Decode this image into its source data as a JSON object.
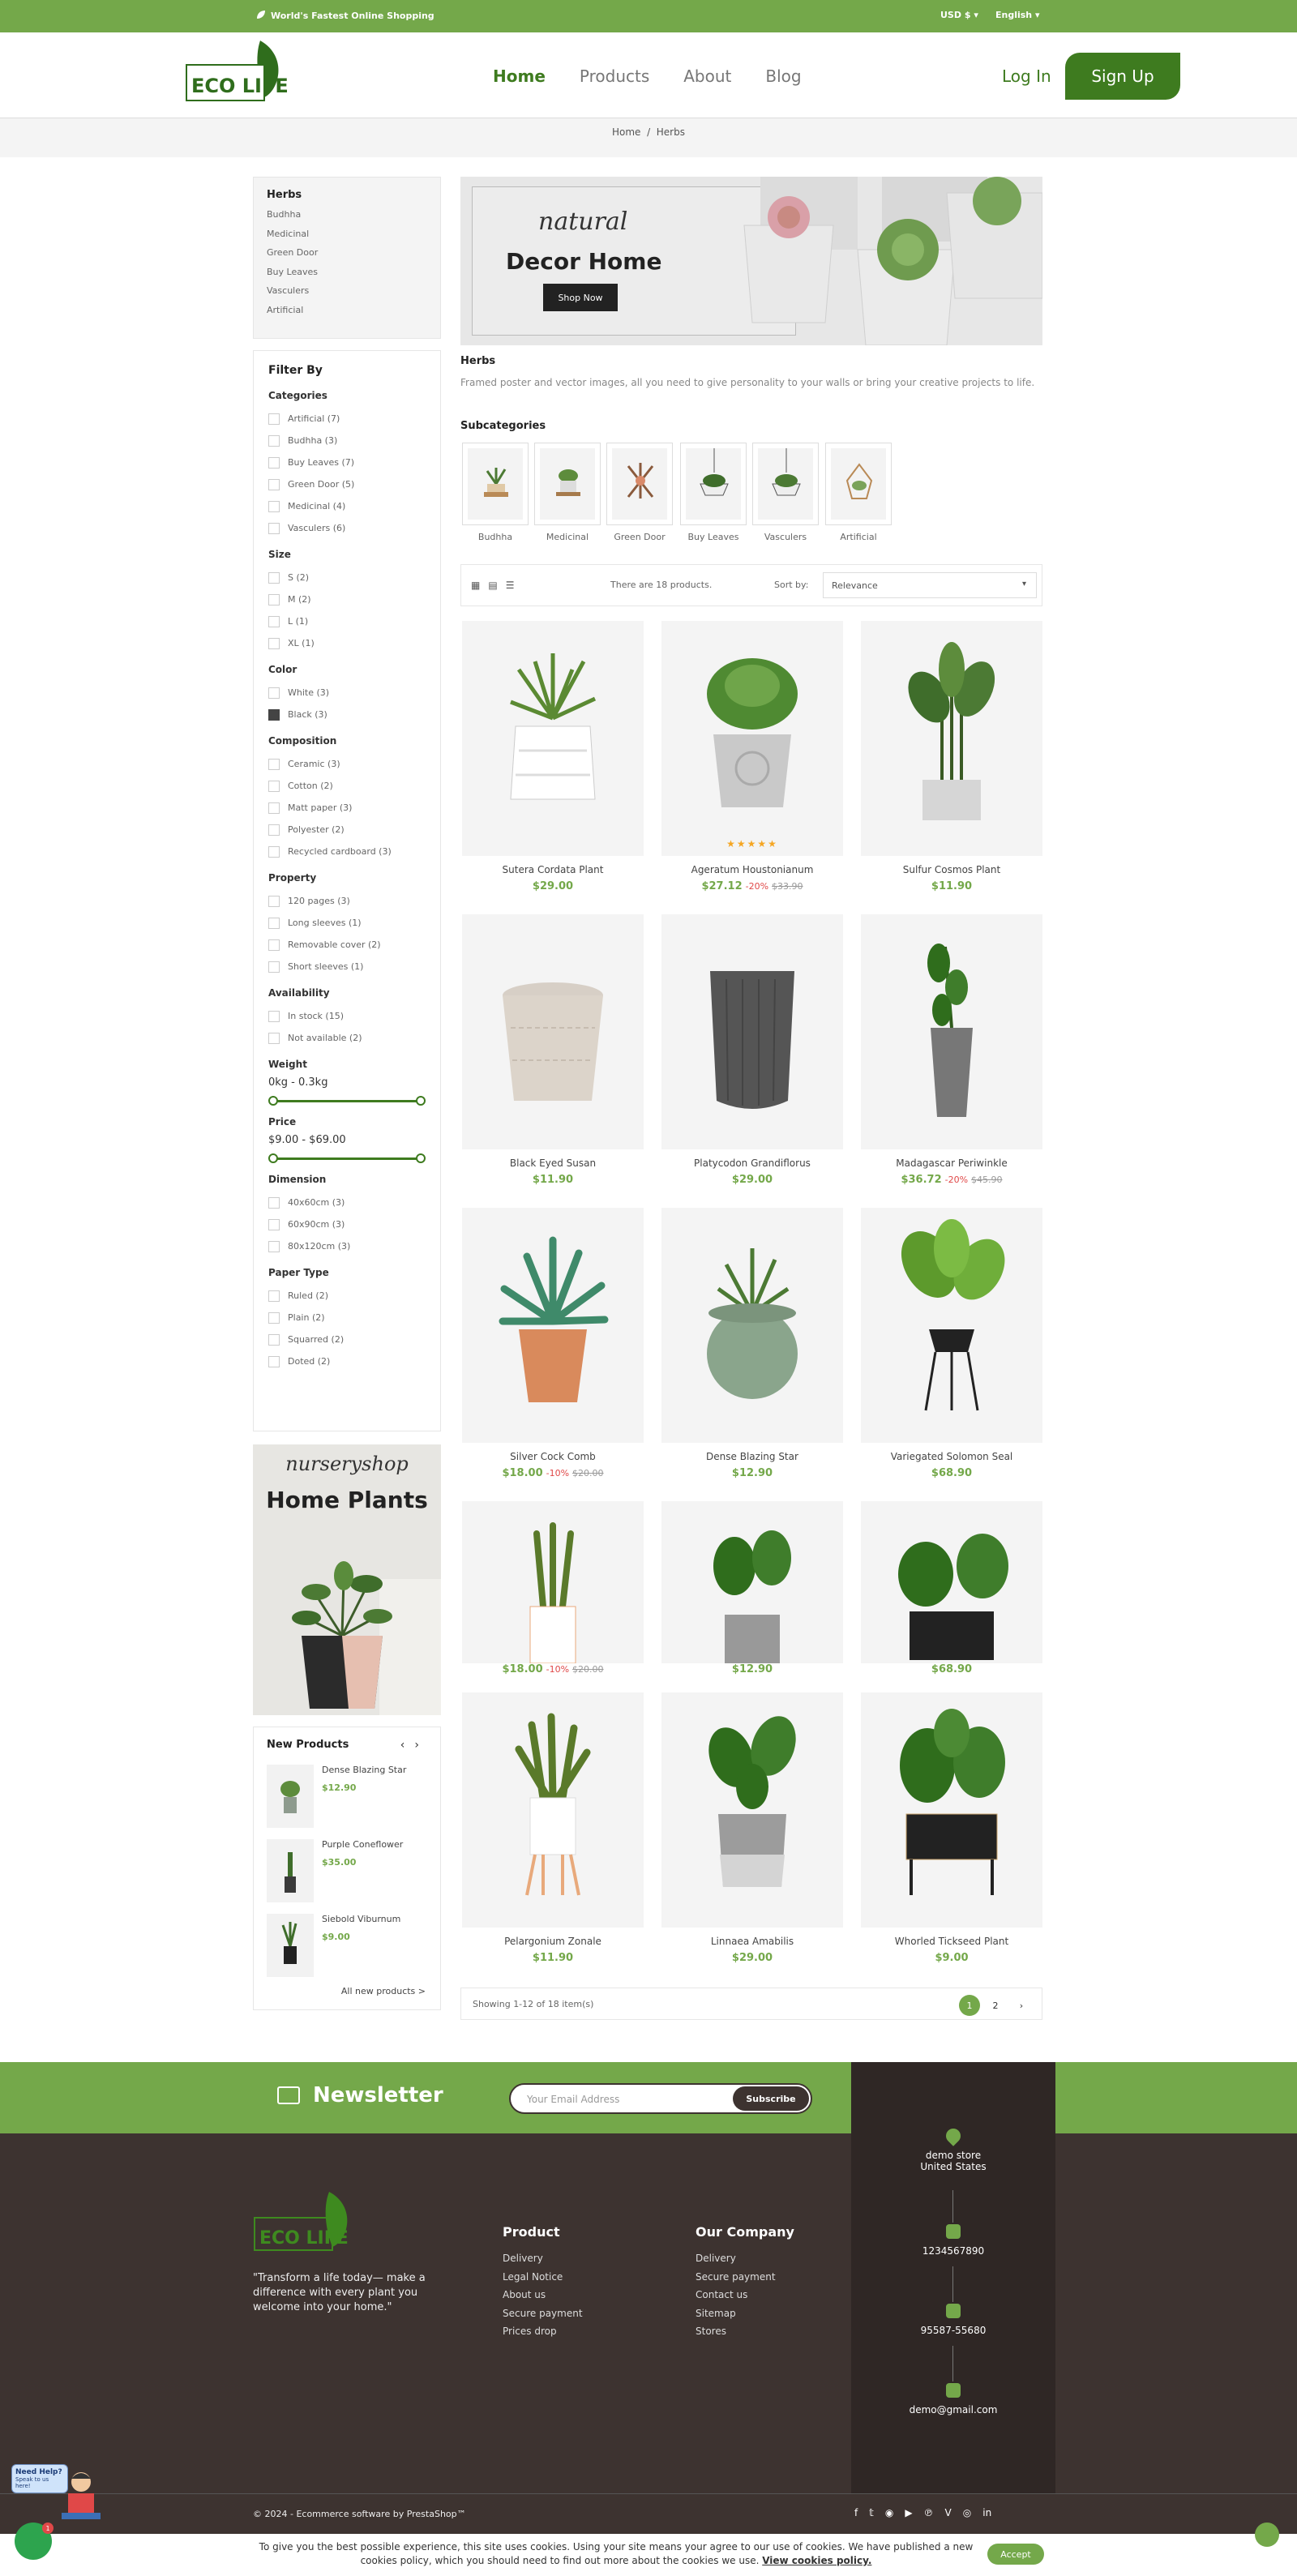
{
  "topbar": {
    "tagline": "World's Fastest Online Shopping",
    "currency": "USD $",
    "language": "English"
  },
  "header": {
    "logo_text": "ECO LIFE",
    "nav": [
      "Home",
      "Products",
      "About",
      "Blog"
    ],
    "login": "Log In",
    "signup": "Sign Up"
  },
  "breadcrumb": {
    "home": "Home",
    "sep": "/",
    "current": "Herbs"
  },
  "category_box": {
    "title": "Herbs",
    "items": [
      "Budhha",
      "Medicinal",
      "Green Door",
      "Buy Leaves",
      "Vasculers",
      "Artificial"
    ]
  },
  "filters": {
    "title": "Filter By",
    "categories": {
      "title": "Categories",
      "items": [
        "Artificial (7)",
        "Budhha (3)",
        "Buy Leaves (7)",
        "Green Door (5)",
        "Medicinal (4)",
        "Vasculers (6)"
      ]
    },
    "size": {
      "title": "Size",
      "items": [
        "S (2)",
        "M (2)",
        "L (1)",
        "XL (1)"
      ]
    },
    "color": {
      "title": "Color",
      "items": [
        "White (3)",
        "Black (3)"
      ]
    },
    "composition": {
      "title": "Composition",
      "items": [
        "Ceramic (3)",
        "Cotton (2)",
        "Matt paper (3)",
        "Polyester (2)",
        "Recycled cardboard (3)"
      ]
    },
    "property": {
      "title": "Property",
      "items": [
        "120 pages (3)",
        "Long sleeves (1)",
        "Removable cover (2)",
        "Short sleeves (1)"
      ]
    },
    "availability": {
      "title": "Availability",
      "items": [
        "In stock (15)",
        "Not available (2)"
      ]
    },
    "weight": {
      "title": "Weight",
      "range": "0kg - 0.3kg"
    },
    "price": {
      "title": "Price",
      "range": "$9.00 - $69.00"
    },
    "dimension": {
      "title": "Dimension",
      "items": [
        "40x60cm (3)",
        "60x90cm (3)",
        "80x120cm (3)"
      ]
    },
    "paper_type": {
      "title": "Paper Type",
      "items": [
        "Ruled (2)",
        "Plain (2)",
        "Squarred (2)",
        "Doted (2)"
      ]
    }
  },
  "side_banner": {
    "script": "nurseryshop",
    "title": "Home Plants"
  },
  "new_products": {
    "title": "New Products",
    "items": [
      {
        "name": "Dense Blazing Star",
        "price": "$12.90"
      },
      {
        "name": "Purple Coneflower",
        "price": "$35.00"
      },
      {
        "name": "Siebold Viburnum",
        "price": "$9.00"
      }
    ],
    "all_link": "All new products >"
  },
  "hero": {
    "script": "natural",
    "title": "Decor Home",
    "button": "Shop Now"
  },
  "category": {
    "title": "Herbs",
    "description": "Framed poster and vector images, all you need to give personality to your walls or bring your creative projects to life.",
    "subcategories_title": "Subcategories",
    "subcategories": [
      "Budhha",
      "Medicinal",
      "Green Door",
      "Buy Leaves",
      "Vasculers",
      "Artificial"
    ]
  },
  "toolbar": {
    "count": "There are 18 products.",
    "sort_label": "Sort by:",
    "sort_value": "Relevance"
  },
  "products": [
    {
      "name": "Sutera Cordata Plant",
      "price": "$29.00",
      "discount": "",
      "old": ""
    },
    {
      "name": "Ageratum Houstonianum",
      "price": "$27.12",
      "discount": "-20%",
      "old": "$33.90",
      "rating": 5
    },
    {
      "name": "Sulfur Cosmos Plant",
      "price": "$11.90",
      "discount": "",
      "old": ""
    },
    {
      "name": "Black Eyed Susan",
      "price": "$11.90",
      "discount": "",
      "old": ""
    },
    {
      "name": "Platycodon Grandiflorus",
      "price": "$29.00",
      "discount": "",
      "old": ""
    },
    {
      "name": "Madagascar Periwinkle",
      "price": "$36.72",
      "discount": "-20%",
      "old": "$45.90"
    },
    {
      "name": "Silver Cock Comb",
      "price": "$18.00",
      "discount": "-10%",
      "old": "$20.00"
    },
    {
      "name": "Dense Blazing Star",
      "price": "$12.90",
      "discount": "",
      "old": ""
    },
    {
      "name": "Variegated Solomon Seal",
      "price": "$68.90",
      "discount": "",
      "old": ""
    },
    {
      "name": "",
      "price": "$18.00",
      "discount": "-10%",
      "old": "$20.00"
    },
    {
      "name": "",
      "price": "$12.90",
      "discount": "",
      "old": ""
    },
    {
      "name": "",
      "price": "$68.90",
      "discount": "",
      "old": ""
    },
    {
      "name": "Pelargonium Zonale",
      "price": "$11.90",
      "discount": "",
      "old": ""
    },
    {
      "name": "Linnaea Amabilis",
      "price": "$29.00",
      "discount": "",
      "old": ""
    },
    {
      "name": "Whorled Tickseed Plant",
      "price": "$9.00",
      "discount": "",
      "old": ""
    }
  ],
  "pagination": {
    "showing": "Showing 1-12 of 18 item(s)",
    "pages": [
      "1",
      "2"
    ],
    "next": "›"
  },
  "newsletter": {
    "title": "Newsletter",
    "placeholder": "Your Email Address",
    "button": "Subscribe"
  },
  "footer": {
    "logo_text": "ECO LIFE",
    "quote": "\"Transform a life today— make a difference with every plant you welcome into your home.\"",
    "product_col": {
      "title": "Product",
      "items": [
        "Delivery",
        "Legal Notice",
        "About us",
        "Secure payment",
        "Prices drop"
      ]
    },
    "company_col": {
      "title": "Our Company",
      "items": [
        "Delivery",
        "Secure payment",
        "Contact us",
        "Sitemap",
        "Stores"
      ]
    },
    "contact": {
      "store": "demo store",
      "country": "United States",
      "phone": "1234567890",
      "fax": "95587-55680",
      "email": "demo@gmail.com"
    },
    "copyright": "© 2024 - Ecommerce software by PrestaShop™",
    "socials": [
      "f",
      "t",
      "rss",
      "yt",
      "p",
      "v",
      "ig",
      "in"
    ]
  },
  "cookie": {
    "text": "To give you the best possible experience, this site uses cookies. Using your site means your agree to our use of cookies. We have published a new cookies policy, which you should need to find out more about the cookies we use.",
    "link": "View cookies policy.",
    "accept": "Accept"
  },
  "help": {
    "title": "Need Help?",
    "sub": "Speak to us here!",
    "badge": "1"
  },
  "colors": {
    "brand_green": "#74a84a",
    "dark_green": "#3e7b1f",
    "footer_brown": "#3d3330",
    "sale_red": "#e04848"
  }
}
